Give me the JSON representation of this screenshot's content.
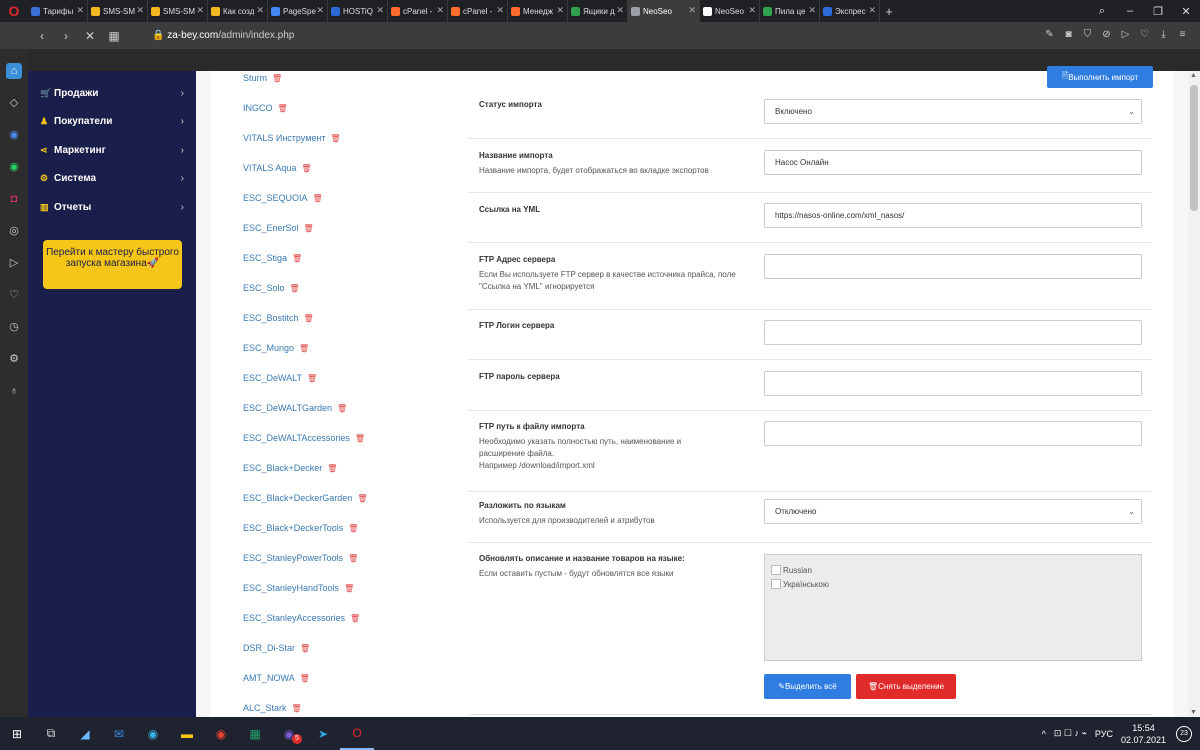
{
  "browser": {
    "tabs": [
      {
        "label": "Тарифы",
        "color": "#3a6fd8",
        "active": false
      },
      {
        "label": "SMS-SM",
        "color": "#f5b820",
        "active": false
      },
      {
        "label": "SMS-SM",
        "color": "#f5b820",
        "active": false
      },
      {
        "label": "Как созд",
        "color": "#f5b820",
        "active": false
      },
      {
        "label": "PageSpe",
        "color": "#4285f4",
        "active": false
      },
      {
        "label": "HOSTiQ",
        "color": "#2a6bd8",
        "active": false
      },
      {
        "label": "cPanel -",
        "color": "#ff6c2c",
        "active": false
      },
      {
        "label": "cPanel -",
        "color": "#ff6c2c",
        "active": false
      },
      {
        "label": "Менедж",
        "color": "#ff6c2c",
        "active": false
      },
      {
        "label": "Ящики д",
        "color": "#2ea04f",
        "active": false
      },
      {
        "label": "NeoSeo",
        "color": "#9aa0a6",
        "active": true
      },
      {
        "label": "NeoSeo",
        "color": "#ffffff",
        "active": false
      },
      {
        "label": "Пила це",
        "color": "#2ea04f",
        "active": false
      },
      {
        "label": "Экспрес",
        "color": "#2a6bd8",
        "active": false
      }
    ],
    "url_host": "za-bey.com",
    "url_path": "/admin/index.php"
  },
  "admin_menu": [
    {
      "label": "Продажи",
      "icon": "cart-icon"
    },
    {
      "label": "Покупатели",
      "icon": "user-icon"
    },
    {
      "label": "Маркетинг",
      "icon": "share-icon"
    },
    {
      "label": "Система",
      "icon": "gear-icon"
    },
    {
      "label": "Отчеты",
      "icon": "bar-chart-icon"
    }
  ],
  "wizard_button": "Перейти к мастеру быстрого запуска магазина",
  "brands": [
    "Sturm",
    "INGCO",
    "VITALS Инструмент",
    "VITALS Aqua",
    "ESC_SEQUOIA",
    "ESC_EnerSol",
    "ESC_Stiga",
    "ESC_Solo",
    "ESC_Bostitch",
    "ESC_Mungo",
    "ESC_DeWALT",
    "ESC_DeWALTGarden",
    "ESC_DeWALTAccessories",
    "ESC_Black+Decker",
    "ESC_Black+DeckerGarden",
    "ESC_Black+DeckerTools",
    "ESC_StanleyPowerTools",
    "ESC_StanleyHandTools",
    "ESC_StanleyAccessories",
    "DSR_Di-Star",
    "AMT_NOWA",
    "ALC_Stark"
  ],
  "import_button": "Выполнить импорт",
  "form": {
    "status": {
      "label": "Статус импорта",
      "value": "Включено"
    },
    "name": {
      "label": "Название импорта",
      "help": "Название импорта, будет отображаться во вкладке экспортов",
      "value": "Насос Онлайн"
    },
    "yml": {
      "label": "Ссылка на YML",
      "value": "https://nasos-online.com/xml_nasos/"
    },
    "ftp_host": {
      "label": "FTP Адрес сервера",
      "help": "Если Вы используете FTP сервер в качестве источника прайса, поле \"Ссылка на YML\" игнорируется",
      "value": ""
    },
    "ftp_login": {
      "label": "FTP Логин сервера",
      "value": ""
    },
    "ftp_pass": {
      "label": "FTP пароль сервера",
      "value": ""
    },
    "ftp_path": {
      "label": "FTP путь к файлу импорта",
      "help": "Необходимо указать полностью путь, наименование и расширение файла.",
      "help2": "Например /download/import.xml",
      "value": ""
    },
    "split_lang": {
      "label": "Разложить по языкам",
      "help": "Используется для производителей и атрибутов",
      "value": "Отключено"
    },
    "update_lang": {
      "label": "Обновлять описание и название товаров на языке:",
      "help": "Если оставить пустым - будут обновлятся все языки",
      "options": [
        "Russian",
        "Українською"
      ]
    }
  },
  "select_all": "Выделить всё",
  "deselect_all": "Снять выделение",
  "taskbar": {
    "time": "15:54",
    "date": "02.07.2021",
    "lang": "РУС",
    "notifications": "23",
    "viber_badge": "5"
  }
}
